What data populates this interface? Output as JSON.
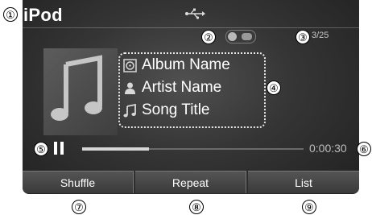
{
  "screen": {
    "title": "iPod",
    "track_count": "3/25",
    "album_name": "Album Name",
    "artist_name": "Artist Name",
    "song_title": "Song Title",
    "elapsed_time": "0:00:30",
    "progress_fraction": 0.3,
    "buttons": {
      "shuffle": "Shuffle",
      "repeat": "Repeat",
      "list": "List"
    }
  },
  "callouts": [
    "①",
    "②",
    "③",
    "④",
    "⑤",
    "⑥",
    "⑦",
    "⑧",
    "⑨"
  ],
  "icons": {
    "usb": "usb-icon",
    "toggle": "connection-toggle-icon",
    "album_art": "music-note-icon",
    "album": "album-icon",
    "artist": "artist-icon",
    "song": "song-icon",
    "pause": "pause-icon"
  },
  "colors": {
    "screen_bg": "#353535",
    "text": "#ffffff",
    "progress_fill": "#d6d6d6",
    "button_bg": "#4a4a4a"
  }
}
